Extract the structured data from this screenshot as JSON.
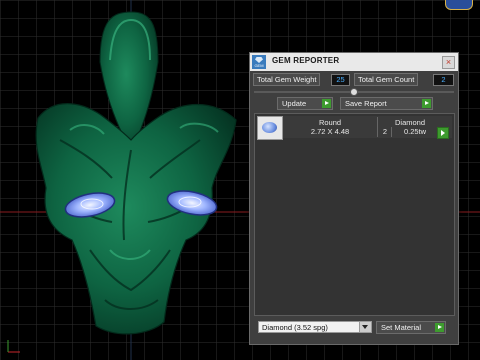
{
  "panel": {
    "title": "GEM REPORTER",
    "logo_text": "GEM",
    "close_label": "×",
    "total_weight_label": "Total Gem Weight",
    "total_weight_value": "25",
    "total_count_label": "Total Gem Count",
    "total_count_value": "2",
    "update_label": "Update",
    "save_report_label": "Save Report",
    "gem_rows": [
      {
        "shape": "Round",
        "size": "2.72 X 4.48",
        "material": "Diamond",
        "count": "2",
        "weight": "0.25tw"
      }
    ],
    "material_select": "Diamond      (3.52 spg)",
    "set_material_label": "Set Material"
  },
  "icons": {
    "logo": "gem-logo-icon",
    "close": "close-icon",
    "play": "green-play-arrow-icon",
    "gem_preview": "round-diamond-thumbnail",
    "dropdown": "chevron-down-icon"
  },
  "colors": {
    "model": "#0c5d3e",
    "panel_bg": "#3f3f3f",
    "accent_green": "#3d9b2e",
    "value_blue": "#4ab0ff",
    "grid": "#3a3a3a",
    "axis_red": "#c8262b"
  }
}
